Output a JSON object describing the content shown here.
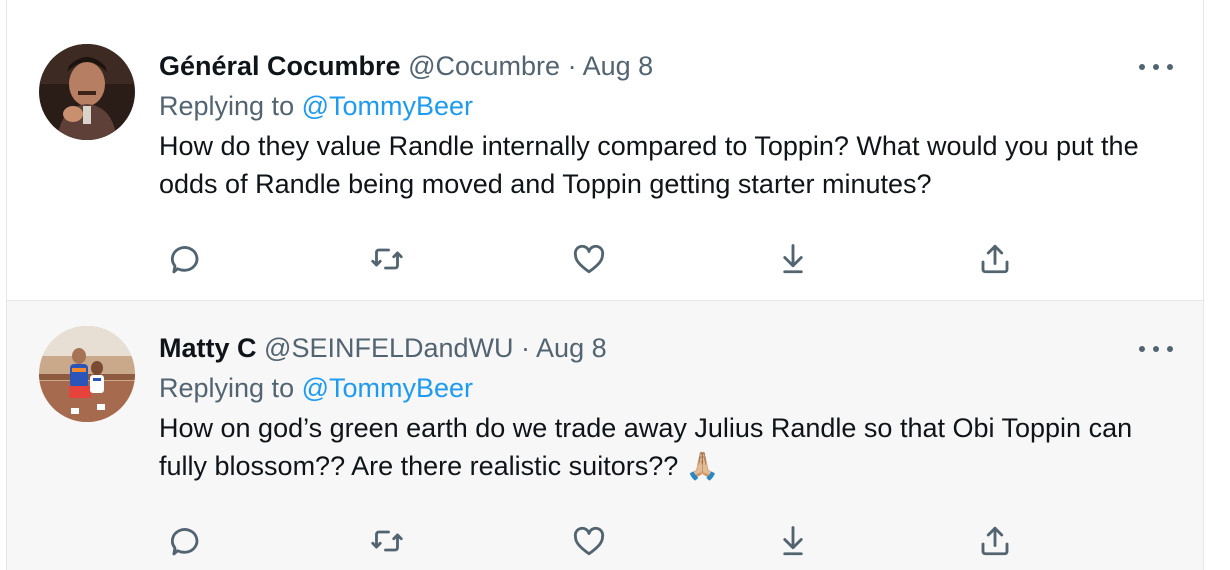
{
  "tweets": [
    {
      "author_name": "Général Cocumbre",
      "handle": "@Cocumbre",
      "separator": "·",
      "date": "Aug 8",
      "replying_prefix": "Replying to",
      "replying_to": "@TommyBeer",
      "text": "How do they value Randle internally compared to Toppin?  What would you put the odds of Randle being moved and Toppin getting starter minutes?"
    },
    {
      "author_name": "Matty C",
      "handle": "@SEINFELDandWU",
      "separator": "·",
      "date": "Aug 8",
      "replying_prefix": "Replying to",
      "replying_to": "@TommyBeer",
      "text": "How on god’s green earth do we trade away Julius Randle so that Obi Toppin can fully blossom?? Are there realistic suitors?? 🙏🏼"
    }
  ],
  "colors": {
    "link": "#1d9bf0",
    "secondary_text": "#536471",
    "primary_text": "#0f1419"
  },
  "icons": [
    "more-icon",
    "reply-icon",
    "retweet-icon",
    "like-icon",
    "share-download-icon",
    "upload-icon"
  ]
}
